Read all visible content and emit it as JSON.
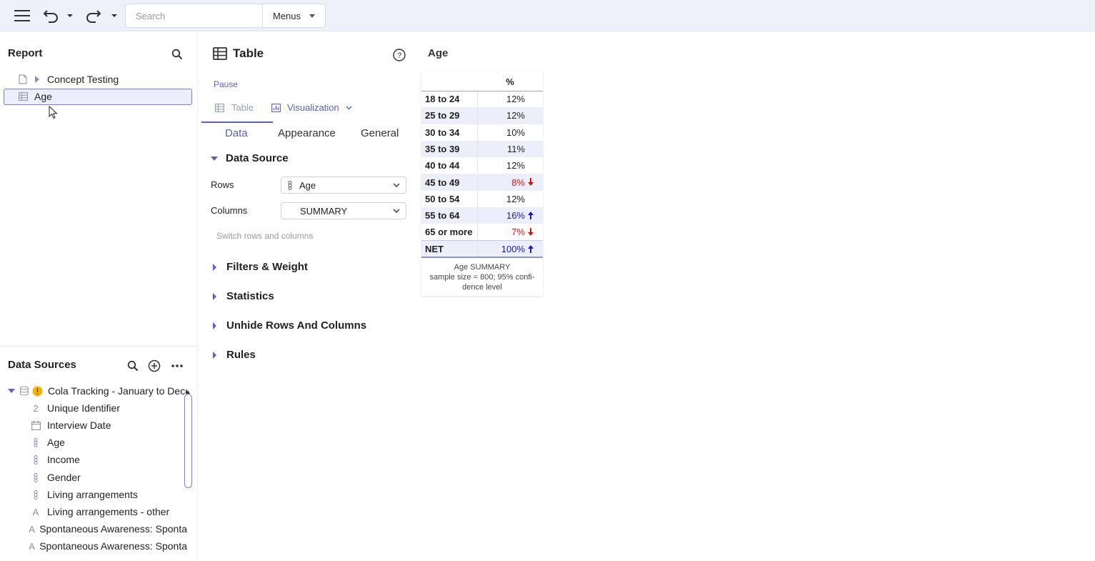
{
  "toolbar": {
    "search_placeholder": "Search",
    "menus_label": "Menus"
  },
  "report": {
    "title": "Report",
    "items": [
      {
        "label": "Concept Testing"
      },
      {
        "label": "Age"
      }
    ]
  },
  "data_sources": {
    "title": "Data Sources",
    "root_label": "Cola Tracking - January to Decer",
    "items": [
      {
        "icon": "2",
        "label": "Unique Identifier"
      },
      {
        "icon": "calendar-icon",
        "label": "Interview Date"
      },
      {
        "icon": "categorical-icon",
        "label": "Age"
      },
      {
        "icon": "categorical-icon",
        "label": "Income"
      },
      {
        "icon": "categorical-icon",
        "label": "Gender"
      },
      {
        "icon": "categorical-icon",
        "label": "Living arrangements"
      },
      {
        "icon": "A",
        "label": "Living arrangements - other"
      },
      {
        "icon": "A",
        "label": "Spontaneous Awareness: Sponta"
      },
      {
        "icon": "A",
        "label": "Spontaneous Awareness: Sponta"
      }
    ]
  },
  "object_panel": {
    "title": "Table",
    "pause_label": "Pause",
    "type_tabs": {
      "table": "Table",
      "visualization": "Visualization"
    },
    "tabs": [
      "Data",
      "Appearance",
      "General"
    ],
    "data_source_section": "Data Source",
    "rows_label": "Rows",
    "rows_value": "Age",
    "columns_label": "Columns",
    "columns_value": "SUMMARY",
    "switch_label": "Switch rows and columns",
    "sections": [
      "Filters & Weight",
      "Statistics",
      "Unhide Rows And Columns",
      "Rules"
    ]
  },
  "output": {
    "title": "Age",
    "column_header": "%",
    "rows": [
      {
        "label": "18 to 24",
        "value": "12%",
        "sig": ""
      },
      {
        "label": "25 to 29",
        "value": "12%",
        "sig": ""
      },
      {
        "label": "30 to 34",
        "value": "10%",
        "sig": ""
      },
      {
        "label": "35 to 39",
        "value": "11%",
        "sig": ""
      },
      {
        "label": "40 to 44",
        "value": "12%",
        "sig": ""
      },
      {
        "label": "45 to 49",
        "value": "8%",
        "sig": "down"
      },
      {
        "label": "50 to 54",
        "value": "12%",
        "sig": ""
      },
      {
        "label": "55 to 64",
        "value": "16%",
        "sig": "up"
      },
      {
        "label": "65 or more",
        "value": "7%",
        "sig": "down"
      },
      {
        "label": "NET",
        "value": "100%",
        "sig": "up"
      }
    ],
    "footer_line1": "Age SUMMARY",
    "footer_line2": "sample size = 800; 95% confi-",
    "footer_line3": "dence level"
  },
  "colors": {
    "accent": "#5a60c8",
    "sig_down": "#e01010",
    "sig_up": "#1616cc"
  }
}
